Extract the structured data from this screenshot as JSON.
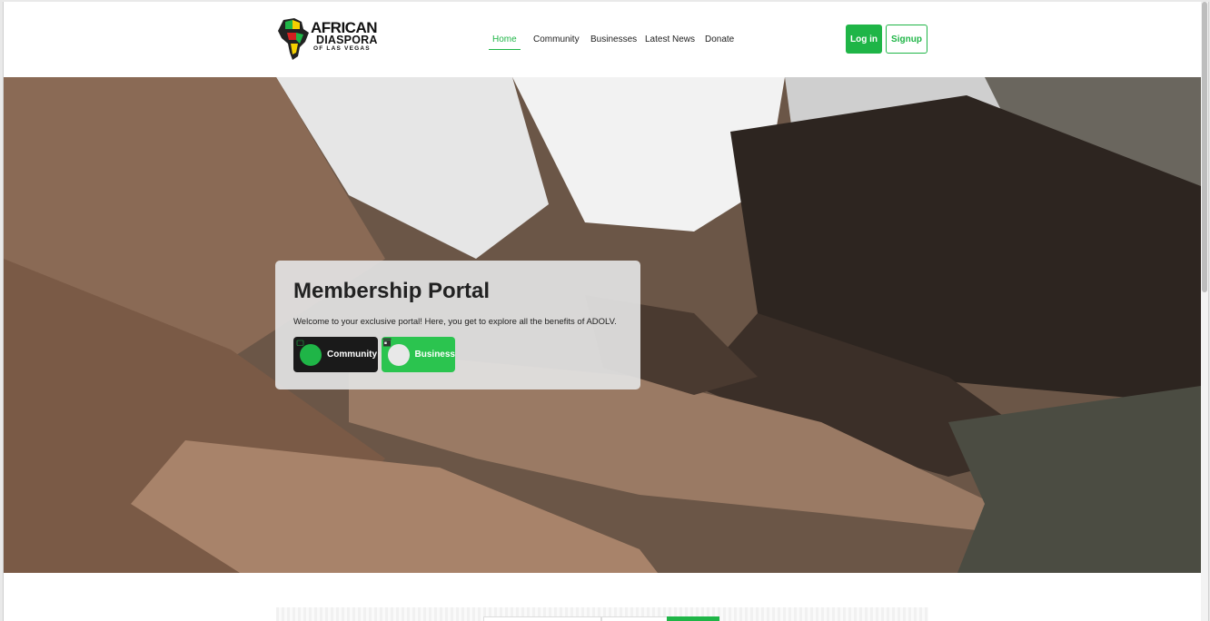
{
  "brand": {
    "line1": "AFRICAN",
    "line2": "DIASPORA",
    "line3": "OF LAS VEGAS",
    "accent_color": "#1fb547"
  },
  "nav": {
    "items": [
      {
        "label": "Home",
        "active": true
      },
      {
        "label": "Community",
        "active": false
      },
      {
        "label": "Businesses",
        "active": false
      },
      {
        "label": "Latest News",
        "active": false
      },
      {
        "label": "Donate",
        "active": false
      }
    ]
  },
  "auth": {
    "login_label": "Log in",
    "signup_label": "Signup"
  },
  "hero": {
    "title": "Membership Portal",
    "subtitle": "Welcome to your exclusive portal! Here, you get to explore all the benefits of ADOLV.",
    "buttons": [
      {
        "label": "Community",
        "icon": "chat-icon"
      },
      {
        "label": "Business",
        "icon": "store-icon"
      }
    ]
  }
}
